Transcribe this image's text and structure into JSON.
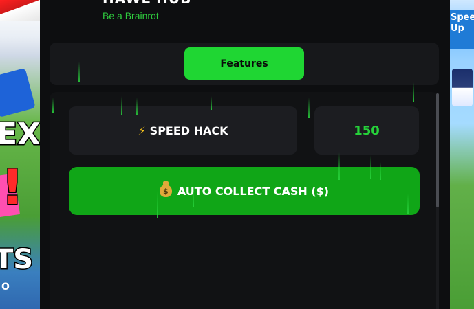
{
  "window": {
    "title": "HAWL HUB",
    "subtitle": "Be a Brainrot"
  },
  "tabs": [
    {
      "label": "Features",
      "active": true
    }
  ],
  "features": {
    "speed_hack": {
      "icon": "lightning-icon",
      "label": "SPEED HACK",
      "value": "150"
    },
    "auto_collect": {
      "icon": "money-bag-icon",
      "label": "AUTO COLLECT CASH ($)"
    }
  },
  "background": {
    "left_text": [
      "EX",
      "!",
      "TS",
      "O"
    ],
    "right_text": "Speed Up"
  },
  "colors": {
    "accent": "#1fd633",
    "button_green": "#10a617",
    "value_green": "#26d13a",
    "panel": "#0d0e10",
    "card": "#1c1d21"
  }
}
